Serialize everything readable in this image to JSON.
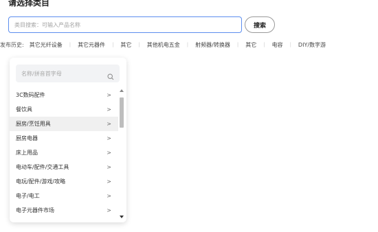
{
  "page": {
    "title": "请选择类目"
  },
  "search": {
    "placeholder": "类目搜索：可输入产品名称",
    "button_label": "搜索"
  },
  "history": {
    "label": "发布历史:",
    "items": [
      "其它光纤设备",
      "其它元器件",
      "其它",
      "其他机电五金",
      "射频器/转换器",
      "其它",
      "电容",
      "DIY/数字游"
    ]
  },
  "category_panel": {
    "filter_placeholder": "名称/拼音首字母",
    "items": [
      {
        "label": "3C数码配件",
        "chevron": ">"
      },
      {
        "label": "餐饮具",
        "chevron": ">"
      },
      {
        "label": "厨房/烹饪用具",
        "chevron": ">",
        "active": true
      },
      {
        "label": "厨房电器",
        "chevron": ">"
      },
      {
        "label": "床上用品",
        "chevron": ">"
      },
      {
        "label": "电动车/配件/交通工具",
        "chevron": ">"
      },
      {
        "label": "电玩/配件/游戏/攻略",
        "chevron": ">"
      },
      {
        "label": "电子/电工",
        "chevron": ">"
      },
      {
        "label": "电子元器件市场",
        "chevron": ">"
      }
    ]
  },
  "colors": {
    "input_border": "#5b8def",
    "active_row": "#f0f0f0"
  }
}
